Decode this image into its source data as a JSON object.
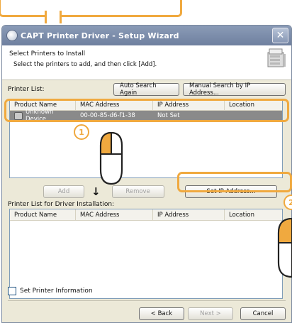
{
  "window": {
    "title": "CAPT Printer Driver - Setup Wizard",
    "close_label": "✕"
  },
  "header": {
    "heading": "Select Printers to Install",
    "subheading": "Select the printers to add, and then click [Add]."
  },
  "printer_list": {
    "label": "Printer List:",
    "auto_search_label": "Auto Search Again",
    "manual_search_label": "Manual Search by IP Address...",
    "columns": [
      "Product Name",
      "MAC Address",
      "IP Address",
      "Location"
    ],
    "rows": [
      {
        "product": "Unknown Device",
        "mac": "00-00-85-d6-f1-38",
        "ip": "Not Set",
        "location": ""
      }
    ]
  },
  "actions": {
    "add_label": "Add",
    "remove_label": "Remove",
    "set_ip_label": "Set IP Address..."
  },
  "install_list": {
    "label": "Printer List for Driver Installation:",
    "columns": [
      "Product Name",
      "MAC Address",
      "IP Address",
      "Location"
    ]
  },
  "options": {
    "set_info_label": "Set Printer Information"
  },
  "footer": {
    "back_label": "< Back",
    "next_label": "Next >",
    "cancel_label": "Cancel"
  },
  "annotations": {
    "step1": "1",
    "step2": "2",
    "accent_color": "#f0a93f"
  }
}
